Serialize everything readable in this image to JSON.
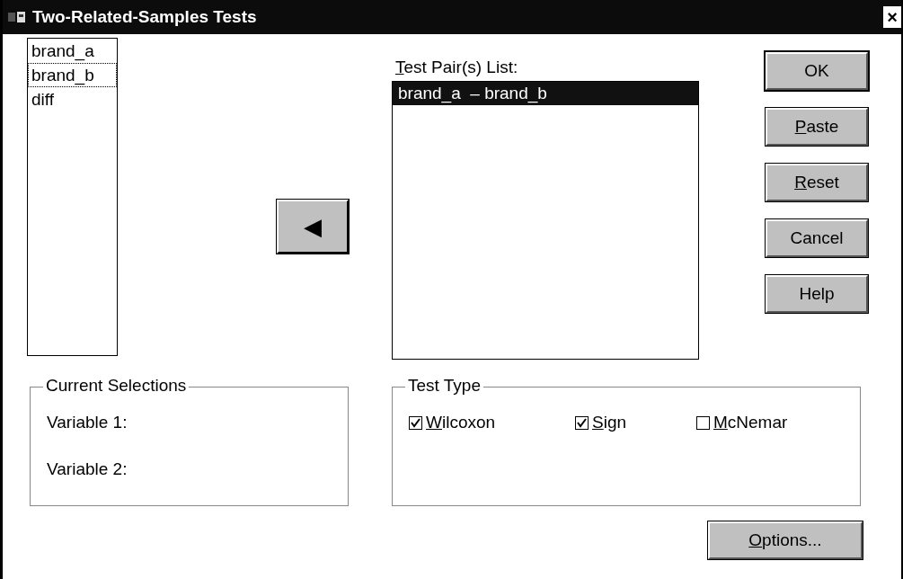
{
  "window": {
    "title": "Two-Related-Samples Tests",
    "close": "×"
  },
  "variables": [
    {
      "name": "brand_a",
      "focused": false
    },
    {
      "name": "brand_b",
      "focused": true
    },
    {
      "name": "diff",
      "focused": false
    }
  ],
  "move_button": {
    "glyph": "◀"
  },
  "pairs": {
    "label": {
      "key": "T",
      "rest": "est Pair(s) List:"
    },
    "items": [
      {
        "first": "brand_a",
        "dash": "–",
        "second": "brand_b",
        "selected": true
      }
    ]
  },
  "buttons": [
    {
      "text": "OK"
    },
    {
      "key": "P",
      "rest": "aste"
    },
    {
      "key": "R",
      "rest": "eset"
    },
    {
      "text": "Cancel"
    },
    {
      "text": "Help"
    }
  ],
  "current_selections": {
    "title": "Current Selections",
    "rows": [
      "Variable 1:",
      "Variable 2:"
    ]
  },
  "test_type": {
    "title": "Test Type",
    "options": [
      {
        "key": "W",
        "rest": "ilcoxon",
        "checked": true
      },
      {
        "key": "S",
        "rest": "ign",
        "checked": true
      },
      {
        "key": "M",
        "rest": "cNemar",
        "checked": false
      }
    ]
  },
  "options_button": {
    "key": "O",
    "rest": "ptions..."
  }
}
